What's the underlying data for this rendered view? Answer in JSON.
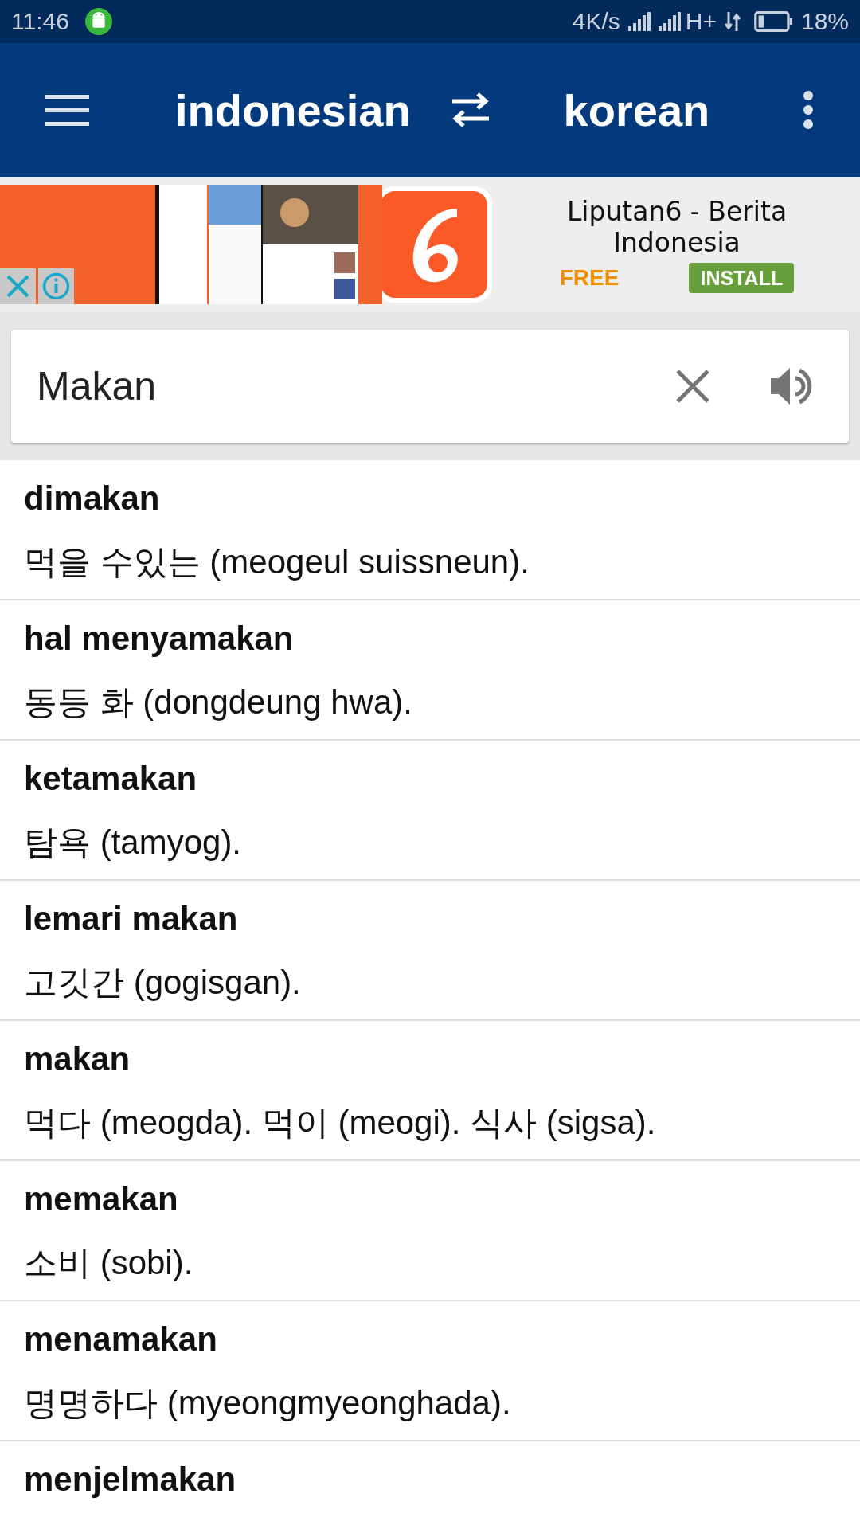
{
  "status_bar": {
    "time": "11:46",
    "speed": "4K/s",
    "network": "H+",
    "battery": "18%"
  },
  "app_bar": {
    "source_language": "indonesian",
    "target_language": "korean"
  },
  "ad": {
    "title": "Liputan6 - Berita Indonesia",
    "price": "FREE",
    "install": "INSTALL"
  },
  "search": {
    "value": "Makan"
  },
  "results": [
    {
      "word": "dimakan",
      "translation": "먹을 수있는 (meogeul suissneun)."
    },
    {
      "word": "hal menyamakan",
      "translation": "동등 화 (dongdeung hwa)."
    },
    {
      "word": "ketamakan",
      "translation": "탐욕 (tamyog)."
    },
    {
      "word": "lemari makan",
      "translation": "고깃간 (gogisgan)."
    },
    {
      "word": "makan",
      "translation": "먹다 (meogda). 먹이 (meogi). 식사 (sigsa)."
    },
    {
      "word": "memakan",
      "translation": "소비 (sobi)."
    },
    {
      "word": "menamakan",
      "translation": "명명하다 (myeongmyeonghada)."
    },
    {
      "word": "menjelmakan"
    }
  ]
}
